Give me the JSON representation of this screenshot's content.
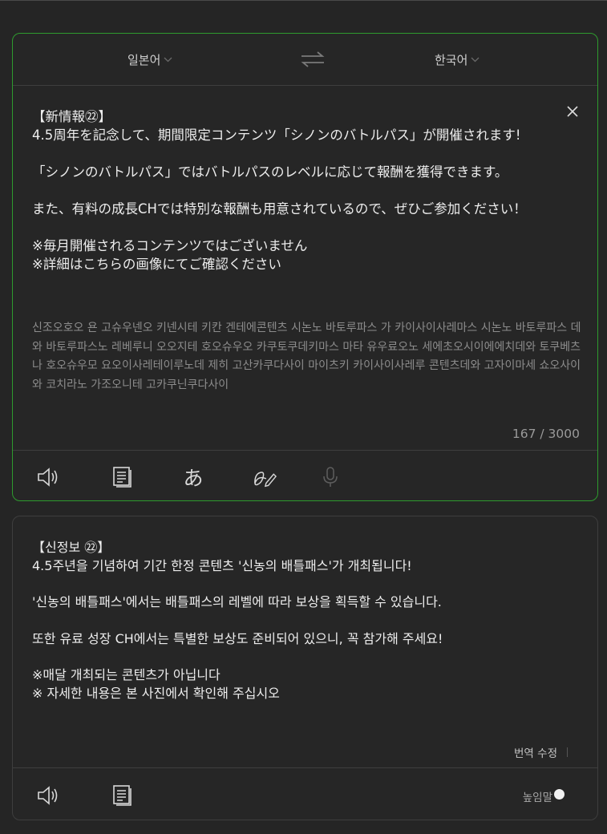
{
  "source_lang": "일본어",
  "target_lang": "한국어",
  "source_text": "【新情報㉒】\n4.5周年を記念して、期間限定コンテンツ「シノンのバトルパス」が開催されます!\n\n「シノンのバトルパス」ではバトルパスのレベルに応じて報酬を獲得できます。\n\nまた、有料の成長CHでは特別な報酬も用意されているので、ぜひご参加ください！\n\n※毎月開催されるコンテンツではございません\n※詳細はこちらの画像にてご確認ください",
  "romanization": "신조오호오 욘 고슈우넨오 키넨시테 키칸 겐테에콘텐츠 시논노 바토루파스 가 카이사이사레마스 시논노 바토루파스 데와 바토루파스노 레베루니 오오지테 호오슈우오 카쿠토쿠데키마스 마타 유우료오노 세에초오시이에에치데와 토쿠베츠나 호오슈우모 요오이사레테이루노데 제히 고산카쿠다사이 마이츠키 카이사이사레루 콘텐츠데와 고자이마세 쇼오사이와 코치라노 가조오니테 고카쿠닌쿠다사이",
  "char_count": "167 / 3000",
  "translation": "【신정보 ㉒】\n4.5주년을 기념하여 기간 한정 콘텐츠 '신농의 배틀패스'가 개최됩니다!\n\n'신농의 배틀패스'에서는 배틀패스의 레벨에 따라 보상을 획득할 수 있습니다.\n\n또한 유료 성장 CH에서는 특별한 보상도 준비되어 있으니, 꼭 참가해 주세요!\n\n※매달 개최되는 콘텐츠가 아닙니다\n※ 자세한 내용은 본 사진에서 확인해 주십시오",
  "edit_translation_label": "번역 수정",
  "honorific_label": "높임말",
  "colors": {
    "accent_border": "#2e9b2e",
    "background": "#252525"
  },
  "icons": [
    "chevron-down-icon",
    "swap-icon",
    "close-icon",
    "speaker-icon",
    "copy-icon",
    "hiragana-icon",
    "handwriting-icon",
    "microphone-icon"
  ]
}
